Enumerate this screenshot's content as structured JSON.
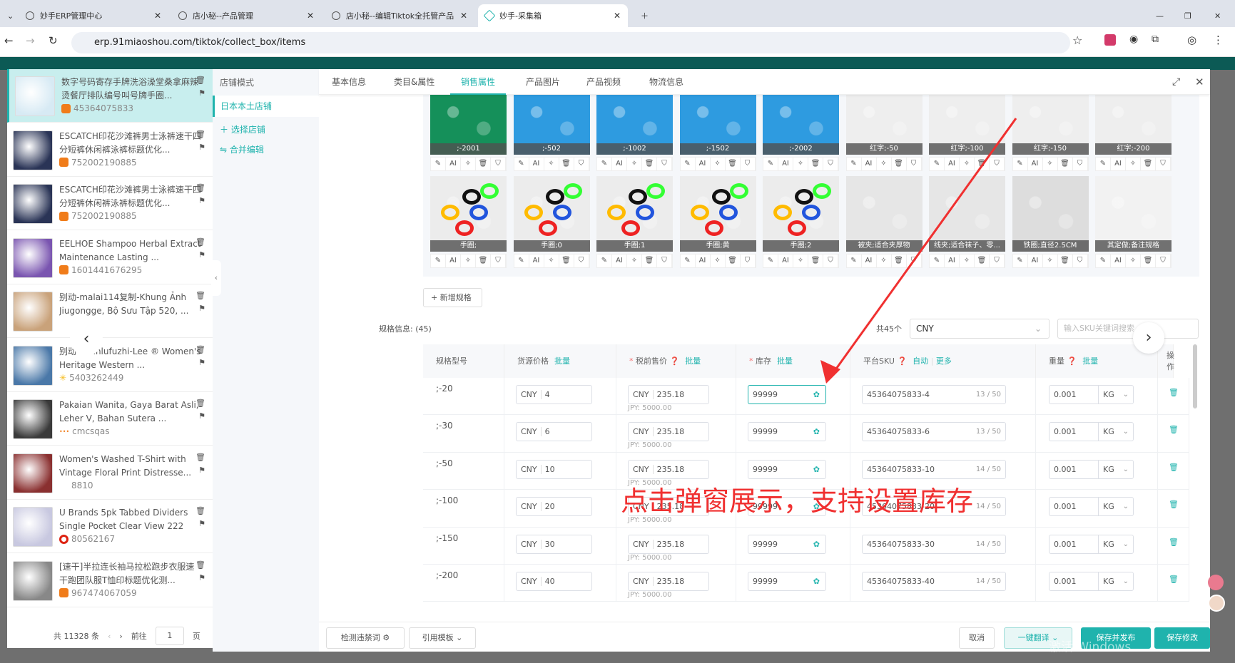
{
  "browser": {
    "tabs": [
      {
        "label": "妙手ERP管理中心"
      },
      {
        "label": "店小秘--产品管理"
      },
      {
        "label": "店小秘--编辑Tiktok全托管产品"
      },
      {
        "label": "妙手-采集箱",
        "active": true
      }
    ],
    "url": "erp.91miaoshou.com/tiktok/collect_box/items"
  },
  "product_list": {
    "items": [
      {
        "title": "数字号码寄存手牌洗浴澡堂桑拿麻辣烫餐厅排队编号叫号牌手圈...",
        "id": "45364075833",
        "source": "1688",
        "color": "#d7eaf4",
        "selected": true
      },
      {
        "title": "ESCATCH印花沙滩裤男士泳裤速干四分短裤休闲裤泳裤标题优化...",
        "id": "752002190885",
        "source": "1688",
        "color": "#2a3456"
      },
      {
        "title": "ESCATCH印花沙滩裤男士泳裤速干四分短裤休闲裤泳裤标题优化...",
        "id": "752002190885",
        "source": "1688",
        "color": "#2a3456"
      },
      {
        "title": "EELHOE  Shampoo Herbal Extract Maintenance Lasting ...",
        "id": "1601441676295",
        "source": "1688",
        "color": "#7a55b0"
      },
      {
        "title": "别动-malai114复制-Khung Ảnh Jiugongge, Bộ Sưu Tập 520, ...",
        "id": "",
        "source": "",
        "color": "#c9a27a"
      },
      {
        "title": "别动-... anlufuzhi-Lee ® Women's Heritage Western ...",
        "id": "5403262449",
        "source": "walmart",
        "color": "#4a78a8"
      },
      {
        "title": "Pakaian Wanita, Gaya Barat Asli, Leher V, Bahan Sutera ...",
        "id": "cmcsqas",
        "source": "other",
        "color": "#3a3a3a"
      },
      {
        "title": "Women's Washed T-Shirt with Vintage Floral Print Distresse...",
        "id": "8810",
        "source": "",
        "color": "#8a3030"
      },
      {
        "title": "U Brands 5pk Tabbed Dividers Single Pocket Clear View 222",
        "id": "80562167",
        "source": "target",
        "color": "#c8c8e0"
      },
      {
        "title": "[速干]半拉连长袖马拉松跑步衣服速干跑团队服T恤印标题优化测...",
        "id": "967474067059",
        "source": "1688",
        "color": "#888"
      }
    ],
    "pagination": {
      "total": "共 11328 条",
      "goto": "前往",
      "page": "1",
      "page_unit": "页"
    }
  },
  "store_panel": {
    "header": "店铺模式",
    "current": "日本本土店铺",
    "select_store": "选择店铺",
    "merge_edit": "合并编辑"
  },
  "tabs": [
    "基本信息",
    "类目&属性",
    "销售属性",
    "产品图片",
    "产品视频",
    "物流信息"
  ],
  "active_tab": "销售属性",
  "variant_images": {
    "tools": [
      "AI"
    ],
    "row1": [
      {
        "label": ";-2001",
        "color": "#15905a"
      },
      {
        "label": ";-502",
        "color": "#2e9be0"
      },
      {
        "label": ";-1002",
        "color": "#2e9be0"
      },
      {
        "label": ";-1502",
        "color": "#2e9be0"
      },
      {
        "label": ";-2002",
        "color": "#2e9be0"
      },
      {
        "label": "红字;-50",
        "color": "#eee"
      },
      {
        "label": "红字;-100",
        "color": "#eee"
      },
      {
        "label": "红字;-150",
        "color": "#eee"
      },
      {
        "label": "红字;-200",
        "color": "#eee"
      }
    ],
    "row2": [
      {
        "label": "手圈;",
        "color": "#ececec"
      },
      {
        "label": "手圈;0",
        "color": "#ececec"
      },
      {
        "label": "手圈;1",
        "color": "#ececec"
      },
      {
        "label": "手圈;黄",
        "color": "#ececec"
      },
      {
        "label": "手圈;2",
        "color": "#ececec"
      },
      {
        "label": "被夹;适合夹厚物",
        "color": "#e6e6e6"
      },
      {
        "label": "线夹;适合袜子、零...",
        "color": "#e6e6e6"
      },
      {
        "label": "铁圈;直径2.5CM",
        "color": "#ddd"
      },
      {
        "label": "其定做;备注规格",
        "color": "#f2f2f2"
      }
    ]
  },
  "add_spec": "+ 新增规格",
  "spec_info": {
    "label": "规格信息:",
    "count": "(45)",
    "total": "共45个",
    "currency": "CNY",
    "search_placeholder": "输入SKU关键词搜索"
  },
  "table": {
    "headers": {
      "spec": "规格型号",
      "source_price": "货源价格",
      "pretax_price": "税前售价",
      "stock": "库存",
      "platform_sku": "平台SKU",
      "weight": "重量",
      "operation": "操作",
      "batch": "批量",
      "auto": "自动",
      "more": "更多"
    },
    "rows": [
      {
        "spec": ";-20",
        "src_cur": "CNY",
        "src_price": "4",
        "cur": "CNY",
        "price": "235.18",
        "jpy": "JPY:  5000.00",
        "stock": "99999",
        "sku": "45364075833-4",
        "sku_count": "13 / 50",
        "weight": "0.001",
        "unit": "KG"
      },
      {
        "spec": ";-30",
        "src_cur": "CNY",
        "src_price": "6",
        "cur": "CNY",
        "price": "235.18",
        "jpy": "JPY:  5000.00",
        "stock": "99999",
        "sku": "45364075833-6",
        "sku_count": "13 / 50",
        "weight": "0.001",
        "unit": "KG"
      },
      {
        "spec": ";-50",
        "src_cur": "CNY",
        "src_price": "10",
        "cur": "CNY",
        "price": "235.18",
        "jpy": "JPY:  5000.00",
        "stock": "99999",
        "sku": "45364075833-10",
        "sku_count": "14 / 50",
        "weight": "0.001",
        "unit": "KG"
      },
      {
        "spec": ";-100",
        "src_cur": "CNY",
        "src_price": "20",
        "cur": "CNY",
        "price": "235.18",
        "jpy": "JPY:  5000.00",
        "stock": "99999",
        "sku": "45364075833-20",
        "sku_count": "14 / 50",
        "weight": "0.001",
        "unit": "KG"
      },
      {
        "spec": ";-150",
        "src_cur": "CNY",
        "src_price": "30",
        "cur": "CNY",
        "price": "235.18",
        "jpy": "JPY:  5000.00",
        "stock": "99999",
        "sku": "45364075833-30",
        "sku_count": "14 / 50",
        "weight": "0.001",
        "unit": "KG"
      },
      {
        "spec": ";-200",
        "src_cur": "CNY",
        "src_price": "40",
        "cur": "CNY",
        "price": "235.18",
        "jpy": "JPY:  5000.00",
        "stock": "99999",
        "sku": "45364075833-40",
        "sku_count": "14 / 50",
        "weight": "0.001",
        "unit": "KG"
      }
    ]
  },
  "footer": {
    "check_words": "检测违禁词",
    "template": "引用模板",
    "cancel": "取消",
    "translate": "一键翻译",
    "save_publish": "保存并发布",
    "save": "保存修改"
  },
  "annotation": "点击弹窗展示，支持设置库存",
  "watermark": "激活 Windows",
  "colors": {
    "accent": "#1fb3ad",
    "annotation": "#f03030"
  }
}
